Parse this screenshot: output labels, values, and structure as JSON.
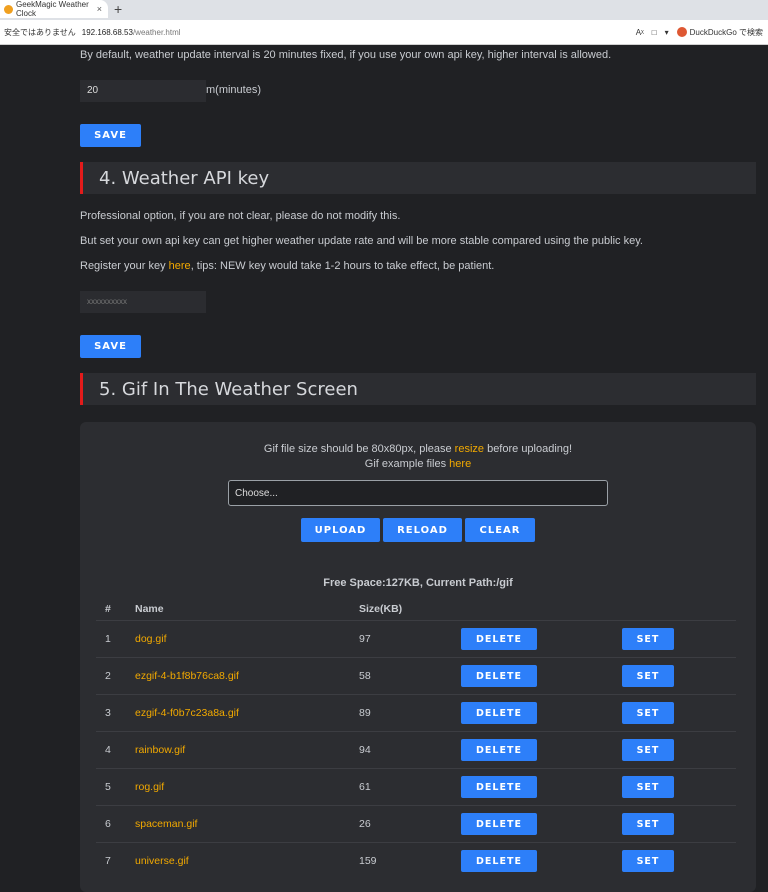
{
  "browser": {
    "tab_title": "GeekMagic Weather Clock",
    "tab_close": "×",
    "new_tab": "+",
    "security_text": "安全ではありません",
    "url_host": "192.168.68.53",
    "url_path": "/weather.html",
    "translate_icon": "Aᵡ",
    "bookmark_icon": "🔖",
    "menu_icon": "▾",
    "search_engine": "DuckDuckGo で検索"
  },
  "interval": {
    "description": "By default, weather update interval is 20 minutes fixed, if you use your own api key, higher interval is allowed.",
    "value": "20",
    "unit": "m(minutes)",
    "save_label": "SAVE"
  },
  "api_key": {
    "heading": "4. Weather API key",
    "line1": "Professional option, if you are not clear, please do not modify this.",
    "line2": "But set your own api key can get higher weather update rate and will be more stable compared using the public key.",
    "line3_prefix": "Register your key ",
    "line3_link": "here",
    "line3_suffix": ", tips: NEW key would take 1-2 hours to take effect, be patient.",
    "placeholder": "xxxxxxxxxx",
    "save_label": "SAVE"
  },
  "gif": {
    "heading": "5. Gif In The Weather Screen",
    "note1_prefix": "Gif file size should be 80x80px, please ",
    "note1_link": "resize",
    "note1_suffix": " before uploading!",
    "note2_prefix": "Gif example files ",
    "note2_link": "here",
    "choose_placeholder": "Choose...",
    "upload_label": "UPLOAD",
    "reload_label": "RELOAD",
    "clear_label": "CLEAR",
    "free_space": "Free Space:127KB, Current Path:/gif",
    "columns": [
      "#",
      "Name",
      "Size(KB)"
    ],
    "delete_label": "DELETE",
    "set_label": "SET",
    "files": [
      {
        "num": "1",
        "name": "dog.gif",
        "size": "97"
      },
      {
        "num": "2",
        "name": "ezgif-4-b1f8b76ca8.gif",
        "size": "58"
      },
      {
        "num": "3",
        "name": "ezgif-4-f0b7c23a8a.gif",
        "size": "89"
      },
      {
        "num": "4",
        "name": "rainbow.gif",
        "size": "94"
      },
      {
        "num": "5",
        "name": "rog.gif",
        "size": "61"
      },
      {
        "num": "6",
        "name": "spaceman.gif",
        "size": "26"
      },
      {
        "num": "7",
        "name": "universe.gif",
        "size": "159"
      }
    ]
  }
}
